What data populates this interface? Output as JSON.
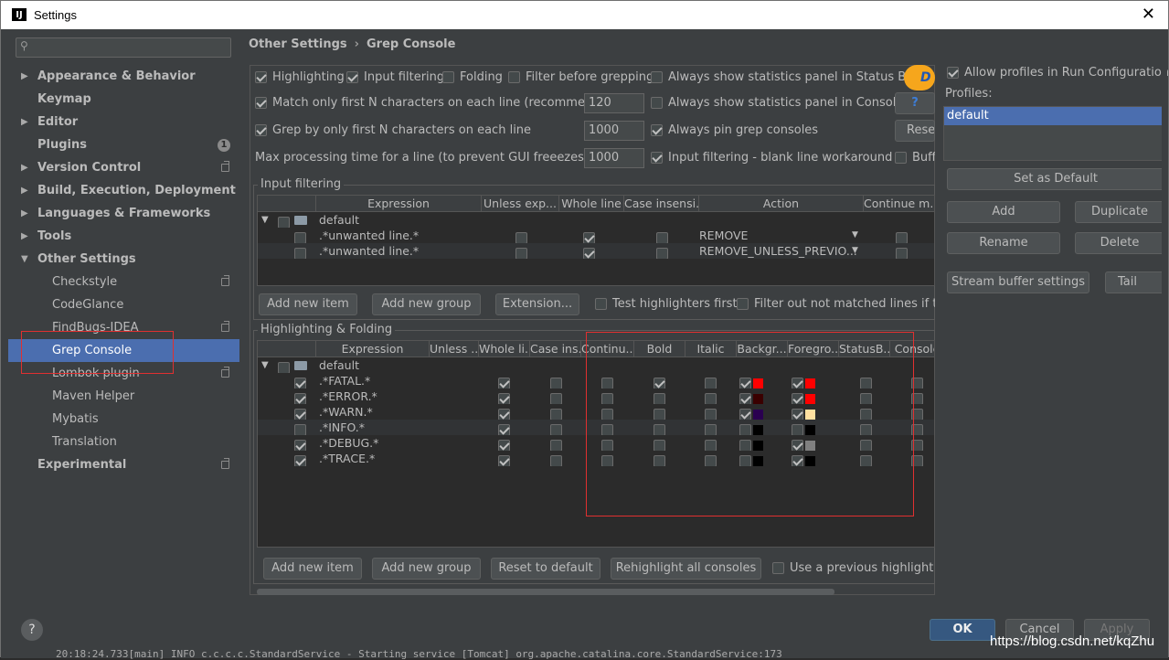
{
  "window": {
    "title": "Settings",
    "close_glyph": "✕"
  },
  "search": {
    "placeholder": "",
    "icon": "search-icon"
  },
  "tree": [
    {
      "label": "Appearance & Behavior",
      "bold": true,
      "arrow": "▶"
    },
    {
      "label": "Keymap",
      "bold": true
    },
    {
      "label": "Editor",
      "bold": true,
      "arrow": "▶"
    },
    {
      "label": "Plugins",
      "bold": true,
      "badge": "1"
    },
    {
      "label": "Version Control",
      "bold": true,
      "arrow": "▶",
      "ext": true
    },
    {
      "label": "Build, Execution, Deployment",
      "bold": true,
      "arrow": "▶"
    },
    {
      "label": "Languages & Frameworks",
      "bold": true,
      "arrow": "▶"
    },
    {
      "label": "Tools",
      "bold": true,
      "arrow": "▶"
    },
    {
      "label": "Other Settings",
      "bold": true,
      "arrow": "▼"
    },
    {
      "label": "Checkstyle",
      "sub": true,
      "ext": true
    },
    {
      "label": "CodeGlance",
      "sub": true
    },
    {
      "label": "FindBugs-IDEA",
      "sub": true,
      "ext": true
    },
    {
      "label": "Grep Console",
      "sub": true,
      "selected": true
    },
    {
      "label": "Lombok plugin",
      "sub": true,
      "ext": true
    },
    {
      "label": "Maven Helper",
      "sub": true
    },
    {
      "label": "Mybatis",
      "sub": true
    },
    {
      "label": "Translation",
      "sub": true
    },
    {
      "label": "Experimental",
      "bold": true,
      "ext": true
    }
  ],
  "breadcrumb": {
    "parent": "Other Settings",
    "sep": "›",
    "current": "Grep Console"
  },
  "options": {
    "highlighting": "Highlighting",
    "input_filtering": "Input filtering",
    "folding": "Folding",
    "filter_before": "Filter before grepping",
    "stats_status": "Always show statistics panel in Status Bar",
    "match_first": "Match only first N characters on each line (recommended)",
    "match_first_value": "120",
    "stats_console": "Always show statistics panel in Console",
    "grep_first": "Grep by only first N characters on each line",
    "grep_first_value": "1000",
    "pin": "Always pin grep consoles",
    "reset": "Reset",
    "max_time": "Max processing time for a line (to prevent GUI freeezes) [ms]",
    "max_time_value": "1000",
    "blank_line": "Input filtering - blank line workaround",
    "buff": "Buff",
    "plugin_logo": "D",
    "question": "?"
  },
  "input_filtering": {
    "title": "Input filtering",
    "headers": [
      "Expression",
      "Unless exp...",
      "Whole line",
      "Case insensi...",
      "Action",
      "Continue m..."
    ],
    "group": "default",
    "rows": [
      {
        "expr": ".*unwanted line.*",
        "whole": true,
        "action": "REMOVE"
      },
      {
        "expr": ".*unwanted line.*",
        "whole": true,
        "action": "REMOVE_UNLESS_PREVIO..."
      }
    ],
    "buttons": {
      "add_item": "Add new item",
      "add_group": "Add new group",
      "extension": "Extension...",
      "test_first": "Test highlighters first",
      "filter_out": "Filter out not matched lines if the"
    }
  },
  "highlighting": {
    "title": "Highlighting & Folding",
    "headers": [
      "Expression",
      "Unless ...",
      "Whole li...",
      "Case ins...",
      "Continu...",
      "Bold",
      "Italic",
      "Backgr...",
      "Foregro...",
      "StatusB...",
      "Console"
    ],
    "group": "default",
    "rows": [
      {
        "on": true,
        "expr": ".*FATAL.*",
        "whole": true,
        "bold": true,
        "bg_on": true,
        "bg": "#ff0000",
        "fg_on": true,
        "fg": "#ff0000"
      },
      {
        "on": true,
        "expr": ".*ERROR.*",
        "whole": true,
        "bold": false,
        "bg_on": true,
        "bg": "#3a0000",
        "fg_on": true,
        "fg": "#ff0000"
      },
      {
        "on": true,
        "expr": ".*WARN.*",
        "whole": true,
        "bold": false,
        "bg_on": true,
        "bg": "#2a0050",
        "fg_on": true,
        "fg": "#ffe0a0"
      },
      {
        "on": false,
        "expr": ".*INFO.*",
        "whole": true,
        "bold": false,
        "bg_on": false,
        "bg": "#000000",
        "fg_on": false,
        "fg": "#000000"
      },
      {
        "on": true,
        "expr": ".*DEBUG.*",
        "whole": true,
        "bold": false,
        "bg_on": false,
        "bg": "#000000",
        "fg_on": true,
        "fg": "#808080"
      },
      {
        "on": true,
        "expr": ".*TRACE.*",
        "whole": true,
        "bold": false,
        "bg_on": false,
        "bg": "#000000",
        "fg_on": true,
        "fg": "#000000"
      }
    ],
    "buttons": {
      "add_item": "Add new item",
      "add_group": "Add new group",
      "reset": "Reset to default",
      "rehighlight": "Rehighlight all consoles",
      "use_prev": "Use a previous highlight if a"
    }
  },
  "profiles": {
    "allow": "Allow profiles in Run Configurations",
    "label": "Profiles:",
    "items": [
      "default"
    ],
    "set_default": "Set as Default",
    "add": "Add",
    "duplicate": "Duplicate",
    "rename": "Rename",
    "delete": "Delete",
    "stream": "Stream buffer settings",
    "tail": "Tail setti"
  },
  "footer": {
    "ok": "OK",
    "cancel": "Cancel",
    "apply": "Apply",
    "help": "?"
  },
  "terminal_line": "20:18:24.733[main] INFO  c.c.c.c.StandardService - Starting service [Tomcat] org.apache.catalina.core.StandardService:173",
  "watermark": "https://blog.csdn.net/kqZhu",
  "colors": {
    "accent": "#4b6eaf",
    "ok_button": "#365880",
    "annotation_red": "#e03030"
  }
}
